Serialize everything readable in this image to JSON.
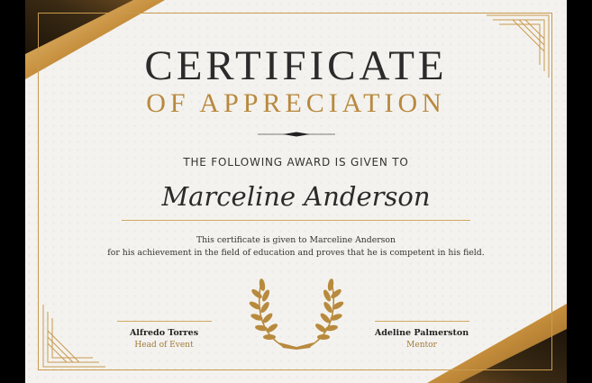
{
  "certificate": {
    "title": "CERTIFICATE",
    "subtitle": "OF APPRECIATION",
    "intro": "THE FOLLOWING AWARD IS GIVEN TO",
    "recipient": "Marceline Anderson",
    "description_line1": "This certificate is given to Marceline Anderson",
    "description_line2": "for his achievement in the field of education and proves that he is competent in his field."
  },
  "signatories": [
    {
      "name": "Alfredo Torres",
      "role": "Head of Event"
    },
    {
      "name": "Adeline Palmerston",
      "role": "Mentor"
    }
  ],
  "colors": {
    "gold": "#c99a4e",
    "dark": "#2b2b2b",
    "background": "#f4f2ee"
  },
  "icons": {
    "emblem": "laurel-wreath-icon",
    "divider": "ornamental-divider-icon"
  }
}
